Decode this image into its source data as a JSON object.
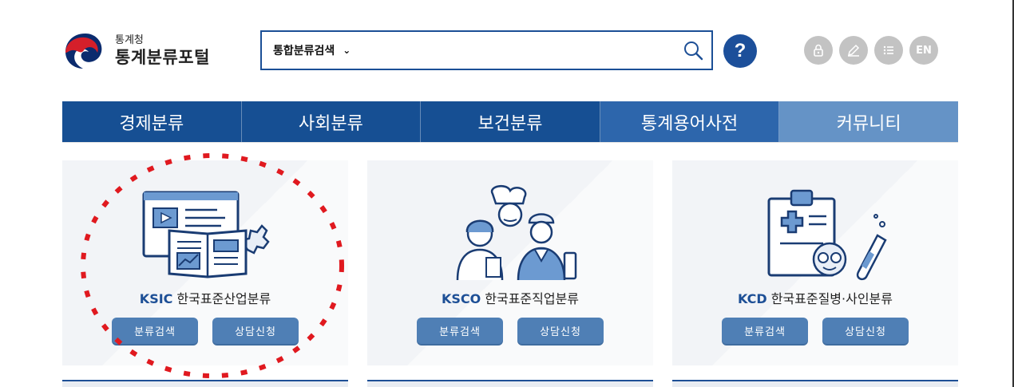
{
  "header": {
    "logo_small": "통계청",
    "logo_big": "통계분류포털",
    "search": {
      "selected": "통합분류검색",
      "placeholder": ""
    },
    "help_label": "?",
    "utilities": [
      {
        "name": "lock-icon"
      },
      {
        "name": "pencil-icon"
      },
      {
        "name": "list-icon"
      },
      {
        "name": "language-en",
        "label": "EN"
      }
    ]
  },
  "nav": [
    {
      "label": "경제분류",
      "color": "#164f93"
    },
    {
      "label": "사회분류",
      "color": "#164f93"
    },
    {
      "label": "보건분류",
      "color": "#164f93"
    },
    {
      "label": "통계용어사전",
      "color": "#2d66ac"
    },
    {
      "label": "커뮤니티",
      "color": "#6593c6"
    }
  ],
  "cards": [
    {
      "code": "KSIC",
      "title": "한국표준산업분류",
      "btn_search": "분류검색",
      "btn_consult": "상담신청",
      "icon": "industry-book-icon"
    },
    {
      "code": "KSCO",
      "title": "한국표준직업분류",
      "btn_search": "분류검색",
      "btn_consult": "상담신청",
      "icon": "occupation-people-icon"
    },
    {
      "code": "KCD",
      "title": "한국표준질병·사인분류",
      "btn_search": "분류검색",
      "btn_consult": "상담신청",
      "icon": "medical-chart-icon"
    }
  ],
  "colors": {
    "primary": "#1d4f96",
    "button": "#4f7fb5",
    "highlight": "#e0191f"
  }
}
